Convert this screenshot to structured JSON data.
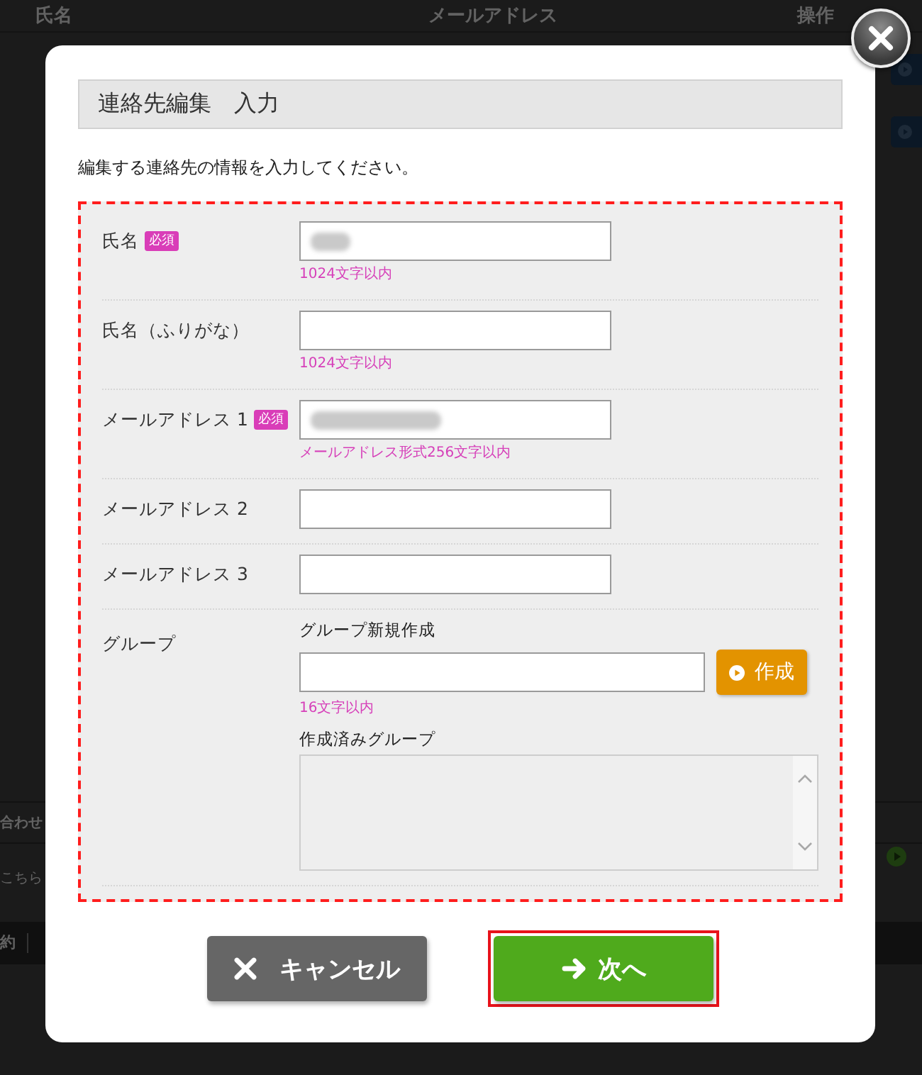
{
  "background": {
    "table_header": [
      "氏名",
      "メールアドレス",
      "操作"
    ],
    "section_heading": "合わせ",
    "section_text": "こちら",
    "footer_link": "約"
  },
  "dialog": {
    "title": "連絡先編集　入力",
    "description": "編集する連絡先の情報を入力してください。",
    "form": {
      "highlighted": true,
      "fields": [
        {
          "label": "氏名",
          "badge": "必須",
          "blurred": true,
          "hint": "1024文字以内"
        },
        {
          "label": "氏名（ふりがな）",
          "blurred": false,
          "hint": "1024文字以内"
        },
        {
          "label": "メールアドレス 1",
          "badge": "必須",
          "blurred": true,
          "hint": "メールアドレス形式256文字以内"
        },
        {
          "label": "メールアドレス 2",
          "blurred": false
        },
        {
          "label": "メールアドレス 3",
          "blurred": false
        }
      ],
      "group": {
        "label": "グループ",
        "new_group_label": "グループ新規作成",
        "create_button": "作成",
        "hint": "16文字以内",
        "existing_label": "作成済みグループ"
      }
    },
    "buttons": [
      {
        "label": "キャンセル",
        "kind": "cancel",
        "highlighted": false
      },
      {
        "label": "次へ",
        "kind": "next",
        "highlighted": true
      }
    ]
  }
}
